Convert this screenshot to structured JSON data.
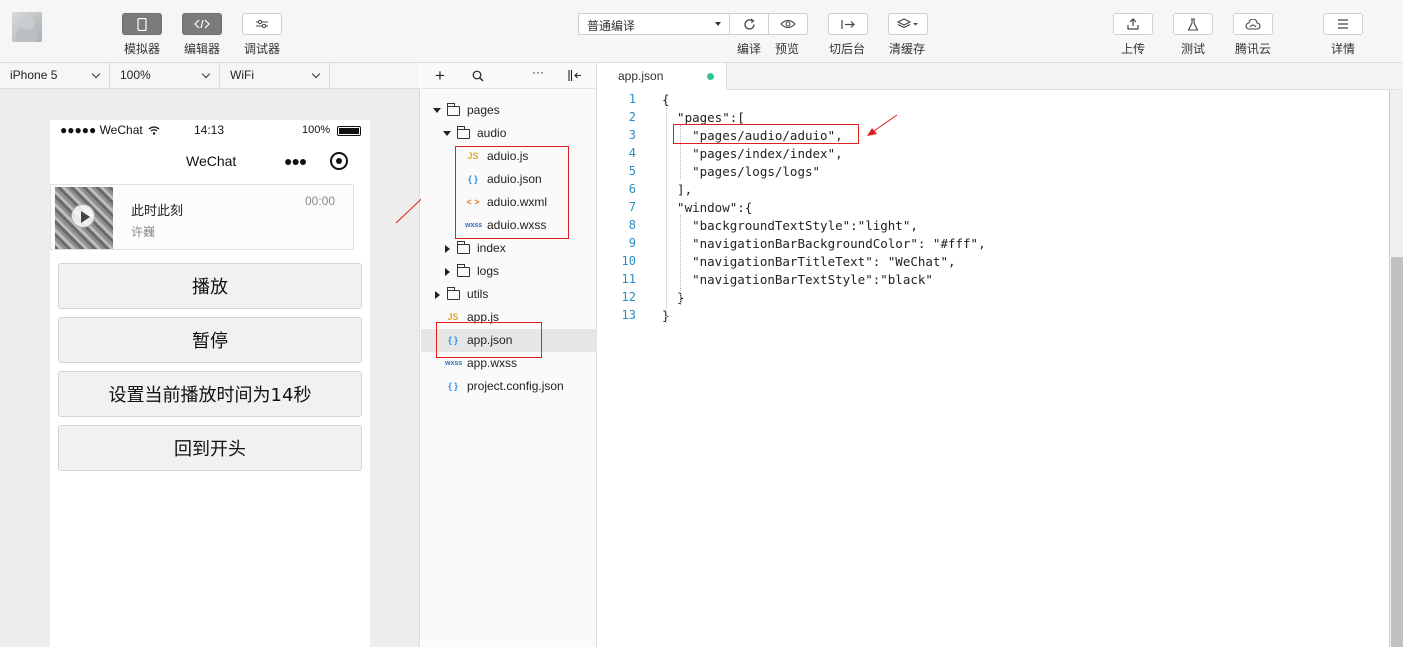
{
  "toolbar": {
    "simulator": "模拟器",
    "editor": "编辑器",
    "debugger": "调试器",
    "compile_mode": "普通编译",
    "compile": "编译",
    "preview": "预览",
    "background": "切后台",
    "clear_cache": "清缓存",
    "upload": "上传",
    "test": "测试",
    "tencent_cloud": "腾讯云",
    "details": "详情"
  },
  "device_bar": {
    "device": "iPhone 5",
    "zoom": "100%",
    "network": "WiFi"
  },
  "phone": {
    "carrier": "●●●●● WeChat",
    "time": "14:13",
    "battery": "100%",
    "nav_title": "WeChat",
    "audio": {
      "title": "此时此刻",
      "author": "许巍",
      "duration": "00:00"
    },
    "buttons": [
      "播放",
      "暂停",
      "设置当前播放时间为14秒",
      "回到开头"
    ]
  },
  "file_tree": {
    "items": [
      {
        "label": "pages",
        "type": "folder",
        "expanded": true
      },
      {
        "label": "audio",
        "type": "folder",
        "expanded": true
      },
      {
        "label": "aduio.js",
        "type": "js"
      },
      {
        "label": "aduio.json",
        "type": "json"
      },
      {
        "label": "aduio.wxml",
        "type": "wxml"
      },
      {
        "label": "aduio.wxss",
        "type": "wxss"
      },
      {
        "label": "index",
        "type": "folder",
        "expanded": false
      },
      {
        "label": "logs",
        "type": "folder",
        "expanded": false
      },
      {
        "label": "utils",
        "type": "folder",
        "expanded": false
      },
      {
        "label": "app.js",
        "type": "js"
      },
      {
        "label": "app.json",
        "type": "json",
        "selected": true
      },
      {
        "label": "app.wxss",
        "type": "wxss"
      },
      {
        "label": "project.config.json",
        "type": "json"
      }
    ],
    "icon_labels": {
      "js": "JS",
      "json": "{ }",
      "wxml": "< >",
      "wxss": "wxss"
    }
  },
  "editor": {
    "tab": "app.json",
    "lines": [
      "{",
      "  \"pages\":[",
      "    \"pages/audio/aduio\",",
      "    \"pages/index/index\",",
      "    \"pages/logs/logs\"",
      "  ],",
      "  \"window\":{",
      "    \"backgroundTextStyle\":\"light\",",
      "    \"navigationBarBackgroundColor\": \"#fff\",",
      "    \"navigationBarTitleText\": \"WeChat\",",
      "    \"navigationBarTextStyle\":\"black\"",
      "  }",
      "}"
    ],
    "line_numbers": [
      "1",
      "2",
      "3",
      "4",
      "5",
      "6",
      "7",
      "8",
      "9",
      "10",
      "11",
      "12",
      "13"
    ]
  },
  "colors": {
    "highlight_red": "#e02020",
    "modified_dot": "#33c48d",
    "line_number": "#2b8fc4"
  }
}
